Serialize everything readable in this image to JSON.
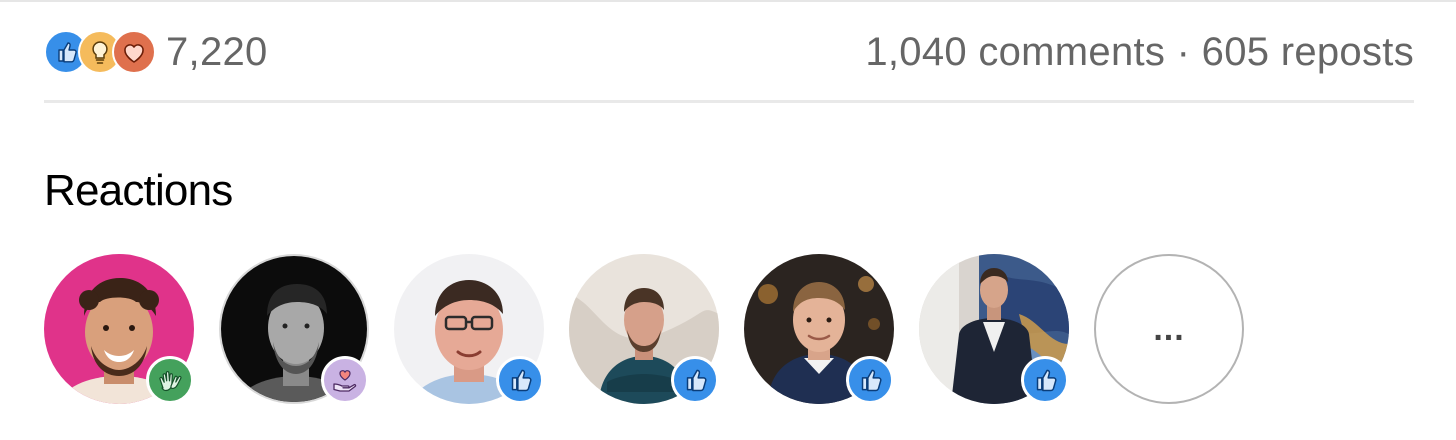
{
  "stats": {
    "reaction_count": "7,220",
    "comments": "1,040 comments",
    "separator": " · ",
    "reposts": "605 reposts",
    "reaction_types": [
      "like-icon",
      "insightful-icon",
      "love-icon"
    ]
  },
  "reactions": {
    "title": "Reactions",
    "more_label": "...",
    "people": [
      {
        "name": "avatar-1",
        "reaction": "celebrate-icon",
        "reaction_color": "#44a15c"
      },
      {
        "name": "avatar-2",
        "reaction": "support-icon",
        "reaction_color": "#c9b2e3"
      },
      {
        "name": "avatar-3",
        "reaction": "like-icon",
        "reaction_color": "#378fe9"
      },
      {
        "name": "avatar-4",
        "reaction": "like-icon",
        "reaction_color": "#378fe9"
      },
      {
        "name": "avatar-5",
        "reaction": "like-icon",
        "reaction_color": "#378fe9"
      },
      {
        "name": "avatar-6",
        "reaction": "like-icon",
        "reaction_color": "#378fe9"
      }
    ]
  },
  "colors": {
    "like": "#378fe9",
    "insightful": "#f5bb5c",
    "love": "#df704d",
    "celebrate": "#44a15c",
    "support": "#c9b2e3",
    "muted_text": "#666666"
  }
}
